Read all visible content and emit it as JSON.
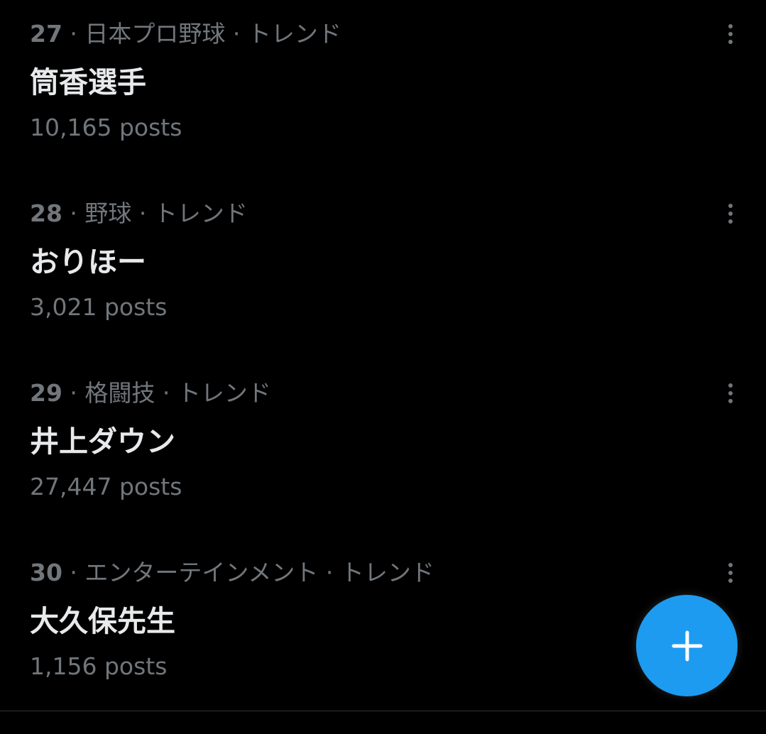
{
  "trends": [
    {
      "rank": "27",
      "separator": " · ",
      "category": "日本プロ野球 · トレンド",
      "title": "筒香選手",
      "posts": "10,165 posts"
    },
    {
      "rank": "28",
      "separator": " · ",
      "category": "野球 · トレンド",
      "title": "おりほー",
      "posts": "3,021 posts"
    },
    {
      "rank": "29",
      "separator": " · ",
      "category": "格闘技 · トレンド",
      "title": "井上ダウン",
      "posts": "27,447 posts"
    },
    {
      "rank": "30",
      "separator": " · ",
      "category": "エンターテインメント · トレンド",
      "title": "大久保先生",
      "posts": "1,156 posts"
    }
  ],
  "icons": {
    "more": "more-vertical-icon",
    "compose": "plus-icon"
  },
  "colors": {
    "background": "#000000",
    "primary_text": "#e7e9ea",
    "secondary_text": "#71767b",
    "accent": "#1d9bf0"
  }
}
